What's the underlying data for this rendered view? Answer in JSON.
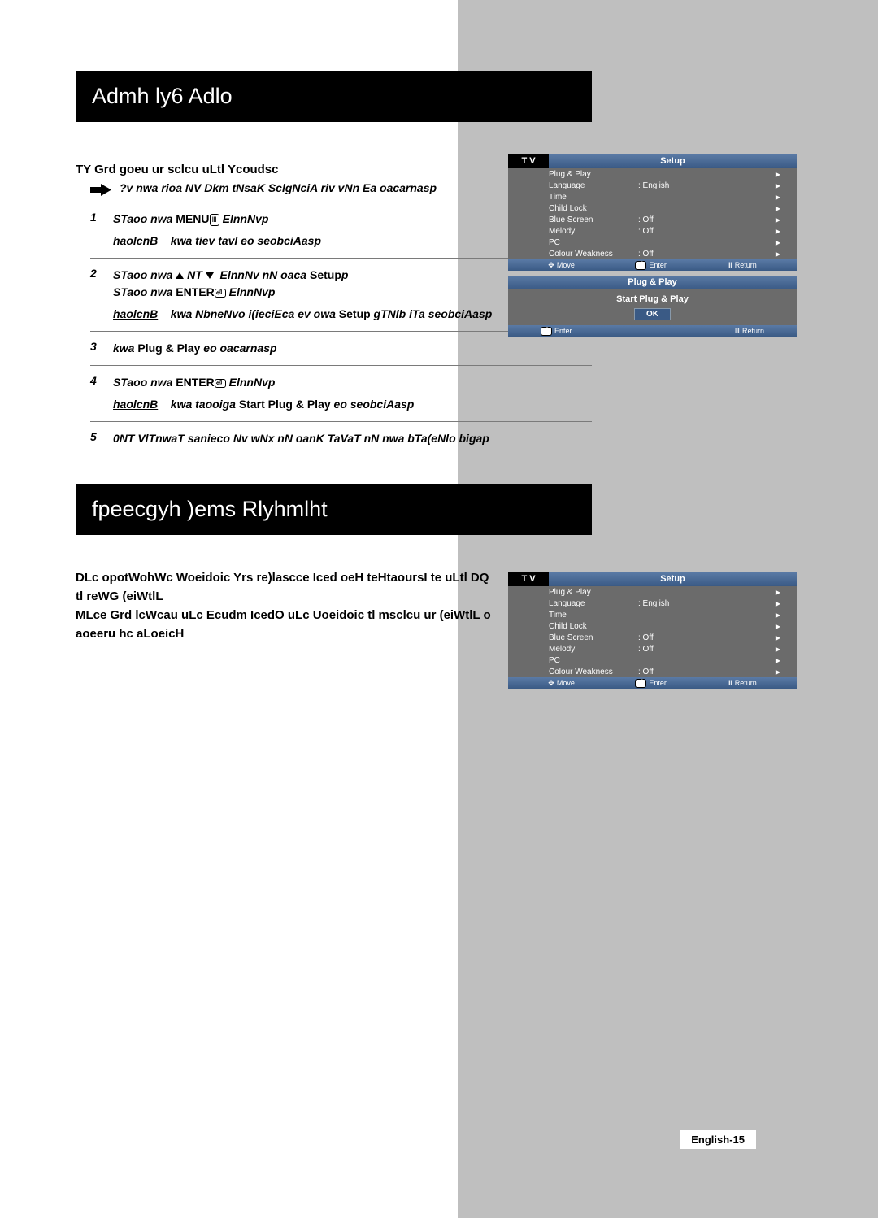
{
  "title1": "Admh ly6 Adlo",
  "title2": "fpeecgyh )ems Rlyhmlht",
  "heading1": "TY Grd goeu ur sclcu uLtl Ycoudsc",
  "arrow_text": "?v nwa rioa NV Dkm tNsaK SclgNciA riv vNn Ea oacarnasp",
  "steps": {
    "s1": {
      "num": "1",
      "line1_pre": "STaoo nwa ",
      "line1_bold": "MENU",
      "line1_post": " ElnnNvp",
      "result_pre": "haolcnB",
      "result_post": "kwa tiev tavl eo seobciAasp"
    },
    "s2": {
      "num": "2",
      "line1_pre": "STaoo nwa ",
      "line1_mid": " NT ",
      "line1_post1": "ElnnNv nN oaca ",
      "line1_setup": "Setup",
      "line1_post2": "p",
      "line2_pre": "STaoo nwa ",
      "line2_enter": "ENTER",
      "line2_post": " ElnnNvp",
      "result_pre": "haolcnB",
      "result_mid1": "kwa NbneNvo i(ieciEca ev owa ",
      "result_setup": "Setup",
      "result_mid2": " gTNlb iTa seobciAasp"
    },
    "s3": {
      "num": "3",
      "line1_pre": "kwa ",
      "line1_bold": "Plug & Play",
      "line1_post": " eo oacarnasp"
    },
    "s4": {
      "num": "4",
      "line1_pre": "STaoo nwa ",
      "line1_enter": "ENTER",
      "line1_post": " ElnnNvp",
      "result_pre": "haolcnB",
      "result_mid": "kwa taooiga ",
      "result_bold": "Start Plug & Play",
      "result_post": " eo seobciAasp"
    },
    "s5": {
      "num": "5",
      "line1": "0NT VlTnwaT sanieco Nv wNx nN oanK TaVaT nN nwa bTa(eNlo bigap"
    }
  },
  "lang_para": {
    "p1": "DLc opotWohWc Woeidoic Yrs re)lascce Iced oeH teHtaoursI te uLtl DQ",
    "p2": "tl reWG (eiWtlL",
    "p3": "MLce Grd lcWcau uLc Ecudm IcedO uLc Uoeidoic tl msclcu ur (eiWtlL o",
    "p4": "aoeeru hc aLoeicH"
  },
  "osd": {
    "tv": "T V",
    "setup": "Setup",
    "plugplay_title": "Plug & Play",
    "start_pp": "Start Plug & Play",
    "ok": "OK",
    "rows": [
      {
        "label": "Plug & Play",
        "value": "",
        "caret": "▶"
      },
      {
        "label": "Language",
        "value": ": English",
        "caret": "▶"
      },
      {
        "label": "Time",
        "value": "",
        "caret": "▶"
      },
      {
        "label": "Child Lock",
        "value": "",
        "caret": "▶"
      },
      {
        "label": "Blue Screen",
        "value": ":  Off",
        "caret": "▶"
      },
      {
        "label": "Melody",
        "value": ":  Off",
        "caret": "▶"
      },
      {
        "label": "PC",
        "value": "",
        "caret": "▶"
      },
      {
        "label": "Colour Weakness",
        "value": ":  Off",
        "caret": "▶"
      }
    ],
    "foot_move": "Move",
    "foot_enter": "Enter",
    "foot_return": "Return"
  },
  "page_foot": "English-15"
}
